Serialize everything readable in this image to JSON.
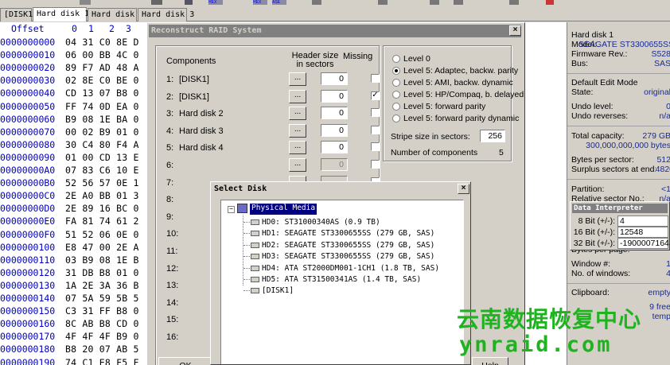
{
  "toolbar": {
    "labels": [
      "HEX",
      "HEX",
      "ASE"
    ]
  },
  "tabs": [
    "[DISK1]",
    "Hard disk 1",
    "Hard disk 2",
    "Hard disk 3"
  ],
  "hex": {
    "offset_label": "Offset",
    "col_labels": [
      "0",
      "1",
      "2",
      "3"
    ],
    "rows": [
      {
        "offset": "0000000000",
        "bytes": "04 31 C0 8E D"
      },
      {
        "offset": "0000000010",
        "bytes": "06 00 BB 4C 0"
      },
      {
        "offset": "0000000020",
        "bytes": "89 F7 AD 48 A"
      },
      {
        "offset": "0000000030",
        "bytes": "02 8E C0 BE 0"
      },
      {
        "offset": "0000000040",
        "bytes": "CD 13 07 B8 0"
      },
      {
        "offset": "0000000050",
        "bytes": "FF 74 0D EA 0"
      },
      {
        "offset": "0000000060",
        "bytes": "B9 08 1E BA 0"
      },
      {
        "offset": "0000000070",
        "bytes": "00 02 B9 01 0"
      },
      {
        "offset": "0000000080",
        "bytes": "30 C4 80 F4 A"
      },
      {
        "offset": "0000000090",
        "bytes": "01 00 CD 13 E"
      },
      {
        "offset": "00000000A0",
        "bytes": "07 83 C6 10 E"
      },
      {
        "offset": "00000000B0",
        "bytes": "52 56 57 0E 1"
      },
      {
        "offset": "00000000C0",
        "bytes": "2E A0 BB 01 3"
      },
      {
        "offset": "00000000D0",
        "bytes": "2E 89 16 BC 0"
      },
      {
        "offset": "00000000E0",
        "bytes": "FA 81 74 61 2"
      },
      {
        "offset": "00000000F0",
        "bytes": "51 52 06 0E 0"
      },
      {
        "offset": "0000000100",
        "bytes": "E8 47 00 2E A"
      },
      {
        "offset": "0000000110",
        "bytes": "03 B9 08 1E B"
      },
      {
        "offset": "0000000120",
        "bytes": "31 DB B8 01 0"
      },
      {
        "offset": "0000000130",
        "bytes": "1A 2E 3A 36 B"
      },
      {
        "offset": "0000000140",
        "bytes": "07 5A 59 5B 5"
      },
      {
        "offset": "0000000150",
        "bytes": "C3 31 FF B8 0"
      },
      {
        "offset": "0000000160",
        "bytes": "8C AB B8 CD 0"
      },
      {
        "offset": "0000000170",
        "bytes": "4F 4F 4F B9 0"
      },
      {
        "offset": "0000000180",
        "bytes": "B8 20 07 AB 5"
      },
      {
        "offset": "0000000190",
        "bytes": "74 C1 E8 F5 F"
      }
    ]
  },
  "raid": {
    "title": "Reconstruct RAID System",
    "close": "×",
    "components_label": "Components",
    "header_size_label": "Header size in sectors",
    "missing_label": "Missing",
    "components": [
      {
        "num": "1:",
        "name": "[DISK1]",
        "header": "0",
        "missing": false,
        "disabled": false
      },
      {
        "num": "2:",
        "name": "[DISK1]",
        "header": "0",
        "missing": true,
        "disabled": false
      },
      {
        "num": "3:",
        "name": "Hard disk 2",
        "header": "0",
        "missing": false,
        "disabled": false
      },
      {
        "num": "4:",
        "name": "Hard disk 3",
        "header": "0",
        "missing": false,
        "disabled": false
      },
      {
        "num": "5:",
        "name": "Hard disk 4",
        "header": "0",
        "missing": false,
        "disabled": false
      },
      {
        "num": "6:",
        "name": "",
        "header": "0",
        "missing": false,
        "disabled": true
      },
      {
        "num": "7:",
        "name": "",
        "header": "",
        "missing": false,
        "disabled": true
      },
      {
        "num": "8:",
        "name": "",
        "header": "",
        "missing": false,
        "disabled": true
      },
      {
        "num": "9:",
        "name": "",
        "header": "",
        "missing": false,
        "disabled": true
      },
      {
        "num": "10:",
        "name": "",
        "header": "",
        "missing": false,
        "disabled": true
      },
      {
        "num": "11:",
        "name": "",
        "header": "",
        "missing": false,
        "disabled": true
      },
      {
        "num": "12:",
        "name": "",
        "header": "",
        "missing": false,
        "disabled": true
      },
      {
        "num": "13:",
        "name": "",
        "header": "",
        "missing": false,
        "disabled": true
      },
      {
        "num": "14:",
        "name": "",
        "header": "",
        "missing": false,
        "disabled": true
      },
      {
        "num": "15:",
        "name": "",
        "header": "",
        "missing": false,
        "disabled": true
      },
      {
        "num": "16:",
        "name": "",
        "header": "",
        "missing": false,
        "disabled": true
      }
    ],
    "dots_label": "...",
    "levels": [
      {
        "label": "Level 0",
        "selected": false
      },
      {
        "label": "Level 5: Adaptec, backw. parity",
        "selected": true
      },
      {
        "label": "Level 5: AMI, backw. dynamic",
        "selected": false
      },
      {
        "label": "Level 5: HP/Compaq, b. delayed",
        "selected": false
      },
      {
        "label": "Level 5: forward parity",
        "selected": false
      },
      {
        "label": "Level 5: forward parity dynamic",
        "selected": false
      }
    ],
    "stripe_label": "Stripe size in sectors:",
    "stripe_value": "256",
    "num_components_label": "Number of components",
    "num_components_value": "5",
    "ok_label": "OK",
    "help_label": "Help"
  },
  "select_disk": {
    "title": "Select Disk",
    "close": "×",
    "root_label": "Physical Media",
    "items": [
      "HD0: ST31000340AS (0.9 TB)",
      "HD1: SEAGATE ST3300655SS (279 GB, SAS)",
      "HD2: SEAGATE ST3300655SS (279 GB, SAS)",
      "HD3: SEAGATE ST3300655SS (279 GB, SAS)",
      "HD4: ATA     ST2000DM001-1CH1 (1.8 TB, SAS)",
      "HD5: ATA     ST31500341AS (1.4 TB, SAS)",
      "[DISK1]"
    ]
  },
  "info": {
    "title": "Hard disk 1",
    "model_k": "Model:",
    "model_v": "SEAGATE ST3300655SS",
    "firmware_k": "Firmware Rev.:",
    "firmware_v": "S528",
    "bus_k": "Bus:",
    "bus_v": "SAS",
    "edit_mode": "Default Edit Mode",
    "state_k": "State:",
    "state_v": "original",
    "undo_level_k": "Undo level:",
    "undo_level_v": "0",
    "undo_rev_k": "Undo reverses:",
    "undo_rev_v": "n/a",
    "capacity_k": "Total capacity:",
    "capacity_v": "279 GB",
    "capacity_bytes": "300,000,000,000 bytes",
    "bps_k": "Bytes per sector:",
    "bps_v": "512",
    "surplus_k": "Surplus sectors at end:",
    "surplus_v": "4820",
    "partition_k": "Partition:",
    "partition_v": "<1",
    "relative_k": "Relative sector No.:",
    "relative_v": "n/a",
    "bytes_per_page": "Bytes per page:",
    "bytes_per_page_v": "",
    "window_k": "Window #:",
    "window_v": "1",
    "windows_k": "No. of windows:",
    "windows_v": "4",
    "clipboard_k": "Clipboard:",
    "clipboard_v": "empty",
    "free_v": "9 free",
    "temp_v": "temp"
  },
  "data_interpreter": {
    "title": "Data Interpreter",
    "rows": [
      {
        "k": "8 Bit (+/-):",
        "v": "4"
      },
      {
        "k": "16 Bit (+/-):",
        "v": "12548"
      },
      {
        "k": "32 Bit (+/-):",
        "v": "-1900007164"
      }
    ]
  },
  "watermark": {
    "line1": "云南数据恢复中心",
    "line2": "ynraid.com"
  }
}
